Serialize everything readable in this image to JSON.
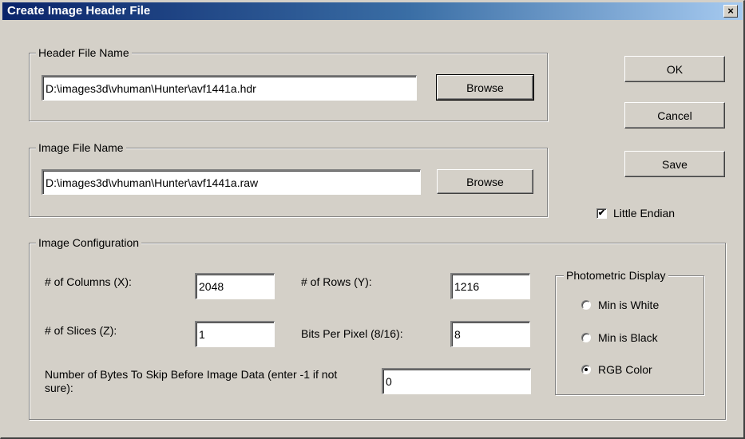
{
  "window": {
    "title": "Create Image Header File",
    "close_glyph": "×"
  },
  "header_file": {
    "legend": "Header File Name",
    "path": "D:\\images3d\\vhuman\\Hunter\\avf1441a.hdr",
    "browse_label": "Browse"
  },
  "image_file": {
    "legend": "Image File Name",
    "path": "D:\\images3d\\vhuman\\Hunter\\avf1441a.raw",
    "browse_label": "Browse"
  },
  "buttons": {
    "ok": "OK",
    "cancel": "Cancel",
    "save": "Save"
  },
  "little_endian": {
    "label": "Little Endian",
    "checked": true,
    "check_glyph": "✔"
  },
  "config": {
    "legend": "Image Configuration",
    "columns_label": "# of Columns (X):",
    "columns_value": "2048",
    "rows_label": "# of Rows (Y):",
    "rows_value": "1216",
    "slices_label": "# of Slices (Z):",
    "slices_value": "1",
    "bits_label": "Bits Per Pixel (8/16):",
    "bits_value": "8",
    "skip_label": "Number of Bytes To Skip Before Image Data (enter -1 if not sure):",
    "skip_value": "0"
  },
  "photometric": {
    "legend": "Photometric Display",
    "options": [
      {
        "label": "Min is White",
        "selected": false
      },
      {
        "label": "Min is Black",
        "selected": false
      },
      {
        "label": "RGB Color",
        "selected": true
      }
    ]
  },
  "colors": {
    "face": "#d4d0c8",
    "title_start": "#0a246a",
    "title_end": "#a6caf0"
  }
}
